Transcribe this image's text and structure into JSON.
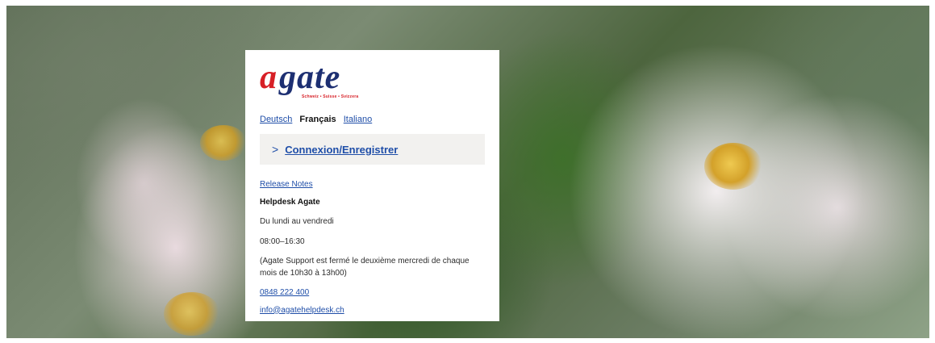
{
  "logo": {
    "brand_a": "a",
    "brand_rest": "gate",
    "tagline": "Schweiz • Suisse • Svizzera"
  },
  "languages": [
    {
      "label": "Deutsch",
      "active": false
    },
    {
      "label": "Français",
      "active": true
    },
    {
      "label": "Italiano",
      "active": false
    }
  ],
  "login": {
    "chevron": ">",
    "label": "Connexion/Enregistrer"
  },
  "links": {
    "release_notes": "Release Notes",
    "phone": "0848 222 400",
    "email": "info@agatehelpdesk.ch"
  },
  "helpdesk": {
    "title": "Helpdesk Agate",
    "days": "Du lundi au vendredi",
    "hours": "08:00–16:30",
    "closure_note": "(Agate Support est fermé le deuxième mercredi de chaque mois de 10h30 à 13h00)"
  },
  "colors": {
    "brand_red": "#d71f26",
    "brand_blue": "#1d2f72",
    "link_blue": "#1f4ea8"
  }
}
